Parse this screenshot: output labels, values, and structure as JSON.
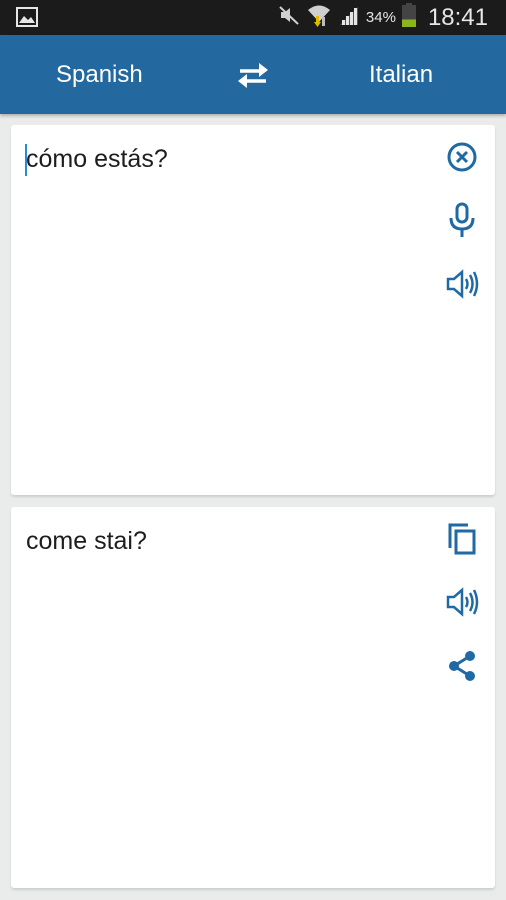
{
  "status_bar": {
    "time": "18:41",
    "battery_percent": "34%",
    "battery_level": 0.34,
    "icons": [
      "gallery-notification-icon",
      "mute-icon",
      "wifi-icon",
      "signal-icon",
      "battery-icon"
    ]
  },
  "app_bar": {
    "source_language": "Spanish",
    "target_language": "Italian",
    "swap_icon": "swap-arrows-icon"
  },
  "source_card": {
    "text": "cómo estás?",
    "actions": [
      "clear-icon",
      "microphone-icon",
      "speaker-icon"
    ]
  },
  "target_card": {
    "text": "come stai?",
    "actions": [
      "copy-icon",
      "speaker-icon",
      "share-icon"
    ]
  },
  "colors": {
    "accent": "#2369a0",
    "icon": "#1f6aa5",
    "background": "#e9ecea",
    "statusbar": "#1b1b1b",
    "caret": "#2b8ad8",
    "battery_fill": "#8ab51b"
  }
}
